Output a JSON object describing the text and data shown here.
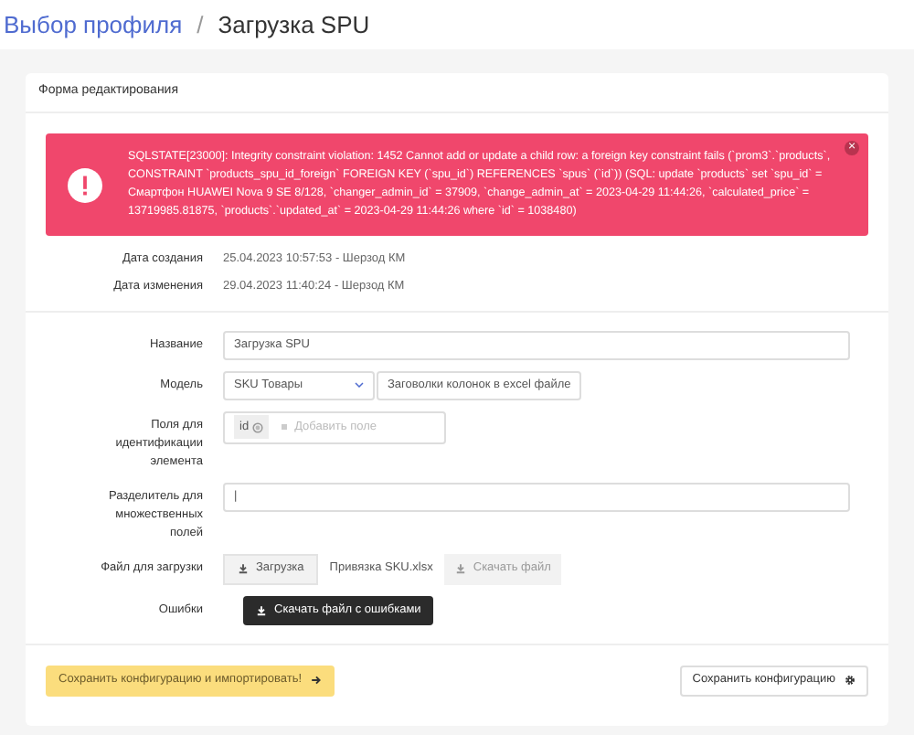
{
  "breadcrumb": [
    {
      "label": "Выбор профиля",
      "kind": "link"
    },
    {
      "label": "/",
      "kind": "separator"
    },
    {
      "label": "Загрузка SPU",
      "kind": "current"
    }
  ],
  "card": {
    "title": "Форма редактирования",
    "alert": {
      "message": "SQLSTATE[23000]: Integrity constraint violation: 1452 Cannot add or update a child row: a foreign key constraint fails (`prom3`.`products`, CONSTRAINT `products_spu_id_foreign` FOREIGN KEY (`spu_id`) REFERENCES `spus` (`id`)) (SQL: update `products` set `spu_id` = Смартфон HUAWEI Nova 9 SE 8/128, `changer_admin_id` = 37909, `change_admin_at` = 2023-04-29 11:44:26, `calculated_price` = 13719985.81875, `products`.`updated_at` = 2023-04-29 11:44:26 where `id` = 1038480)",
      "close": "×"
    },
    "meta": [
      {
        "label": "Дата создания",
        "value": "25.04.2023 10:57:53 - Шерзод КМ"
      },
      {
        "label": "Дата изменения",
        "value": "29.04.2023 11:40:24 - Шерзод КМ"
      }
    ],
    "fields": [
      {
        "kind": "text",
        "label": "Название",
        "value": "Загрузка SPU"
      },
      {
        "kind": "select",
        "label": "Модель",
        "value": "SKU Товары",
        "button": "Заговолки колонок в excel файле"
      },
      {
        "kind": "tags",
        "label": "Поля для идентификации элемента",
        "tags": [
          "id"
        ],
        "placeholder": "Добавить поле"
      },
      {
        "kind": "text",
        "label": "Разделитель для множественных полей",
        "value": "|"
      },
      {
        "kind": "file",
        "label": "Файл для загрузки",
        "upload": "Загрузка",
        "filename": "Привязка SKU.xlsx",
        "download": "Скачать файл"
      },
      {
        "kind": "action",
        "label": "Ошибки",
        "button": "Скачать файл с ошибками"
      }
    ],
    "footer": {
      "primary": "Сохранить конфигурацию и импортировать!",
      "secondary": "Сохранить конфигурацию"
    }
  }
}
